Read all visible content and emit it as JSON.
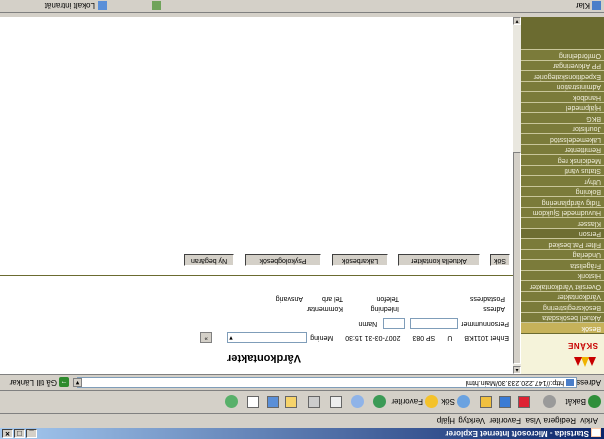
{
  "window": {
    "title": "Startsida - Microsoft Internet Explorer"
  },
  "menu": {
    "items": [
      "Arkiv",
      "Redigera",
      "Visa",
      "Favoriter",
      "Verktyg",
      "Hjälp"
    ]
  },
  "toolbar": {
    "back_label": "Bakåt",
    "search_label": "Sök",
    "favorites_label": "Favoriter"
  },
  "address": {
    "label": "Adress",
    "url": "http://147.220.233.30/Main.html",
    "go_label": "Gå till",
    "links_label": "Länkar"
  },
  "logo": {
    "text": "SKÅNE"
  },
  "sidebar": {
    "items": [
      {
        "label": "Besök"
      },
      {
        "label": "Aktuell besöksdata"
      },
      {
        "label": "Besöksregistrering"
      },
      {
        "label": "Vårdkontakter"
      },
      {
        "label": "Översikt Vårdkontakter"
      },
      {
        "label": "Historik"
      },
      {
        "label": "Frågelista"
      },
      {
        "label": "Underlag"
      },
      {
        "label": "Filter Pat.besked"
      },
      {
        "label": "Person"
      },
      {
        "label": "Klasser"
      },
      {
        "label": "Huvudmedel Sjukdom"
      },
      {
        "label": "Tidig vårdplanering"
      },
      {
        "label": "Bokning"
      },
      {
        "label": "Uthyr"
      },
      {
        "label": "Status väntl"
      },
      {
        "label": "Medicinsk reg"
      },
      {
        "label": "Remittenter"
      },
      {
        "label": "Läkemedelsstöd"
      },
      {
        "label": "Jourlistor"
      },
      {
        "label": "BKG"
      },
      {
        "label": "Hjälpmedel"
      },
      {
        "label": "Handbok"
      },
      {
        "label": "Administration"
      },
      {
        "label": "Expeditionskategorier"
      },
      {
        "label": "PP Arkiveringar"
      },
      {
        "label": "Omfördelning"
      }
    ]
  },
  "page": {
    "title": "Vårdkontakter",
    "unit_label": "Enhet 1011KB",
    "unit_code": "U",
    "sp_code": "SP 083",
    "datetime": "2007-03-31 15:30",
    "select_label": "Mening",
    "personnummer_label": "Personnummer",
    "namn_label": "Namn",
    "adress_label": "Adress",
    "postadress_label": "Postadress",
    "inledning_label": "Inledning",
    "telefon_label": "Telefon",
    "kommentar_label": "Kommentar",
    "telarb_label": "Tel arb",
    "ansvarig_label": "Ansvarig"
  },
  "tabs": [
    "Sök",
    "Aktuella kontakter",
    "Läkarbesök",
    "Psykologbesök",
    "Ny begäran"
  ],
  "status": {
    "left": "Klar",
    "zone": "Lokalt intranät"
  }
}
